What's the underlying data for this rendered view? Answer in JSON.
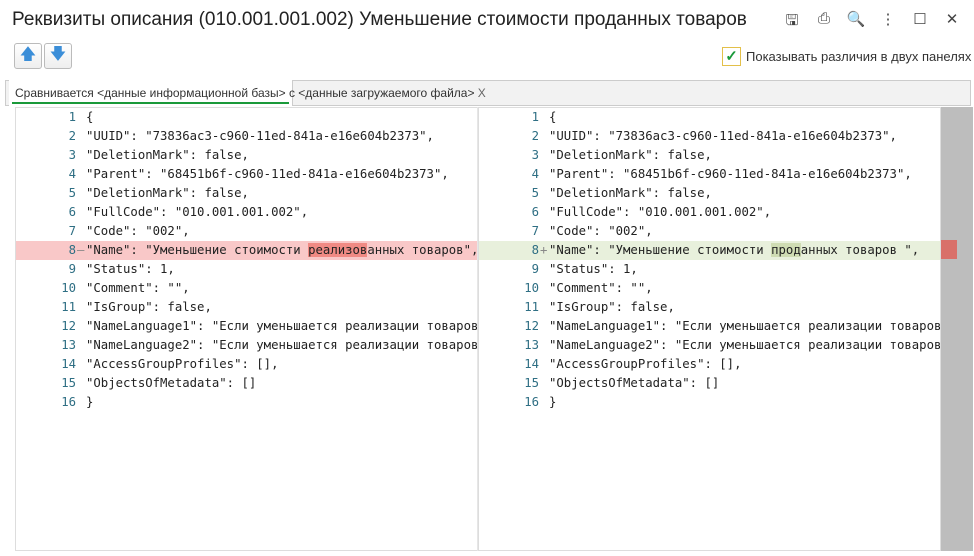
{
  "window": {
    "title": "Реквизиты описания (010.001.001.002) Уменьшение стоимости проданных товаров",
    "buttons": [
      "save-icon",
      "print-icon",
      "preview-icon",
      "more-icon",
      "maximize-icon",
      "close-icon"
    ],
    "glyphs": [
      "🖫",
      "⎙",
      "🔍",
      "⋮",
      "☐",
      "✕"
    ]
  },
  "toolbar": {
    "up": "🡅",
    "down": "🡇",
    "show_diff_label": "Показывать различия в двух панелях",
    "show_diff_checked": true
  },
  "tab": {
    "label": "Сравнивается <данные информационной базы> с <данные загружаемого файла>",
    "close": "X"
  },
  "colors": {
    "accent": "#1a9a3a",
    "deleted": "#f9c8c8",
    "deleted_strong": "#f08a84",
    "inserted": "#e8f0dc",
    "inserted_strong": "#cfdcb3"
  },
  "left": {
    "lines": [
      "{",
      "\"UUID\": \"73836ac3-c960-11ed-841a-e16e604b2373\",",
      "\"DeletionMark\": false,",
      "\"Parent\": \"68451b6f-c960-11ed-841a-e16e604b2373\",",
      "\"DeletionMark\": false,",
      "\"FullCode\": \"010.001.001.002\",",
      "\"Code\": \"002\",",
      "\"Name\": \"Уменьшение стоимости реализованных товаров\",",
      "\"Status\": 1,",
      "\"Comment\": \"\",",
      "\"IsGroup\": false,",
      "\"NameLanguage1\": \"Если уменьшается реализации товаров\",",
      "\"NameLanguage2\": \"Если уменьшается реализации товаров\",",
      "\"AccessGroupProfiles\": [],",
      "\"ObjectsOfMetadata\": []",
      "}"
    ],
    "changed_line": 8,
    "changed_marker": "–",
    "changed_parts": [
      "\"Name\": \"Уменьшение стоимости ",
      "реализов",
      "анных товаров\","
    ]
  },
  "right": {
    "lines": [
      "{",
      "\"UUID\": \"73836ac3-c960-11ed-841a-e16e604b2373\",",
      "\"DeletionMark\": false,",
      "\"Parent\": \"68451b6f-c960-11ed-841a-e16e604b2373\",",
      "\"DeletionMark\": false,",
      "\"FullCode\": \"010.001.001.002\",",
      "\"Code\": \"002\",",
      "\"Name\": \"Уменьшение стоимости проданных товаров \",",
      "\"Status\": 1,",
      "\"Comment\": \"\",",
      "\"IsGroup\": false,",
      "\"NameLanguage1\": \"Если уменьшается реализации товаров\",",
      "\"NameLanguage2\": \"Если уменьшается реализации товаров\",",
      "\"AccessGroupProfiles\": [],",
      "\"ObjectsOfMetadata\": []",
      "}"
    ],
    "changed_line": 8,
    "changed_marker": "+",
    "changed_parts": [
      "\"Name\": \"Уменьшение стоимости ",
      "прод",
      "анных товаров \","
    ]
  }
}
